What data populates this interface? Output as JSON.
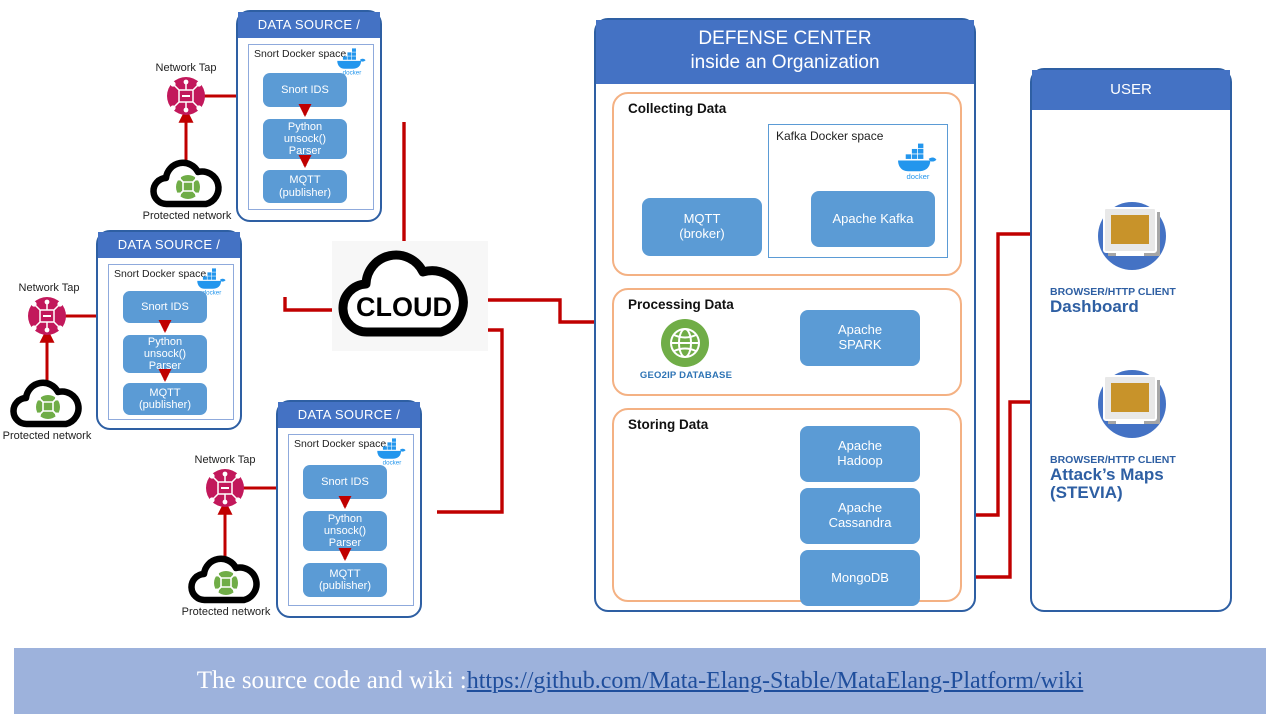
{
  "sensors": [
    {
      "header": "DATA SOURCE / SENSOR",
      "docker_space": "Snort Docker space",
      "docker_logo": "docker-whale-icon",
      "blocks": [
        "Snort IDS",
        "Python\nunsock()\nParser",
        "MQTT\n(publisher)"
      ],
      "network_tap_label": "Network Tap",
      "protected_network_label": "Protected network"
    },
    {
      "header": "DATA SOURCE / SENSOR",
      "docker_space": "Snort Docker space",
      "docker_logo": "docker-whale-icon",
      "blocks": [
        "Snort IDS",
        "Python\nunsock()\nParser",
        "MQTT\n(publisher)"
      ],
      "network_tap_label": "Network Tap",
      "protected_network_label": "Protected network"
    },
    {
      "header": "DATA SOURCE / SENSOR",
      "docker_space": "Snort Docker space",
      "docker_logo": "docker-whale-icon",
      "blocks": [
        "Snort IDS",
        "Python\nunsock()\nParser",
        "MQTT\n(publisher)"
      ],
      "network_tap_label": "Network Tap",
      "protected_network_label": "Protected network"
    }
  ],
  "cloud": {
    "label": "CLOUD"
  },
  "defense_center": {
    "title_line1": "DEFENSE CENTER",
    "title_line2": "inside an Organization",
    "collecting": {
      "title": "Collecting Data",
      "mqtt_broker": "MQTT\n(broker)",
      "kafka_space": "Kafka Docker space",
      "kafka": "Apache Kafka",
      "docker_logo": "docker-whale-icon"
    },
    "processing": {
      "title": "Processing Data",
      "geoip_label": "GEO2IP DATABASE",
      "spark": "Apache\nSPARK"
    },
    "storing": {
      "title": "Storing Data",
      "hadoop": "Apache\nHadoop",
      "cassandra": "Apache\nCassandra",
      "mongodb": "MongoDB"
    }
  },
  "user": {
    "header": "USER",
    "clients": [
      {
        "kind": "BROWSER/HTTP  CLIENT",
        "name": "Dashboard",
        "icon": "monitor-icon"
      },
      {
        "kind": "BROWSER/HTTP  CLIENT",
        "name": "Attack’s Maps\n(STEVIA)",
        "icon": "monitor-icon"
      }
    ]
  },
  "footer": {
    "text": "The source code and wiki : ",
    "link": "https://github.com/Mata-Elang-Stable/MataElang-Platform/wiki"
  },
  "colors": {
    "header_blue": "#4472C4",
    "block_blue": "#5B9BD5",
    "border_blue": "#2E5FA3",
    "group_orange": "#F4B183",
    "arrow_red": "#C00000",
    "tap_magenta": "#C2185B",
    "green": "#70AD47",
    "footer_bg": "#9DB2DC",
    "link_blue": "#1F4E9C",
    "monitor_gold": "#C8932A"
  }
}
